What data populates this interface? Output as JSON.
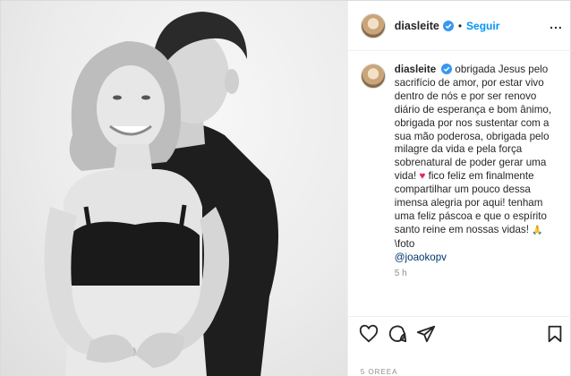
{
  "header": {
    "username": "diasleite",
    "separator": "•",
    "follow_label": "Seguir",
    "more_label": "..."
  },
  "caption": {
    "username": "diasleite",
    "text_part1": "obrigada Jesus pelo sacrifício de amor, por estar vivo dentro de nós e por ser renovo diário de esperança e bom ânimo, obrigada por nos sustentar com a sua mão poderosa, obrigada pelo milagre da vida e pela força sobrenatural de poder gerar uma vida! ",
    "heart_emoji": "♥",
    "text_part2": " fico feliz em finalmente compartilhar um pouco dessa imensa alegria por aqui! tenham uma feliz páscoa e que o espírito santo reine em nossas vidas! ",
    "hands_emoji": "🙏",
    "text_part3": " \\foto ",
    "mention": "@joaokopv",
    "time": "5 h"
  },
  "actions": {
    "like_icon": "heart-outline-icon",
    "comment_icon": "comment-bubble-icon",
    "share_icon": "paper-plane-icon",
    "save_icon": "bookmark-icon"
  },
  "likes_text": "5 OREEA",
  "colors": {
    "link": "#0095f6",
    "verified": "#3897f0",
    "text": "#262626",
    "muted": "#8e8e8e",
    "heart": "#e0245e"
  }
}
